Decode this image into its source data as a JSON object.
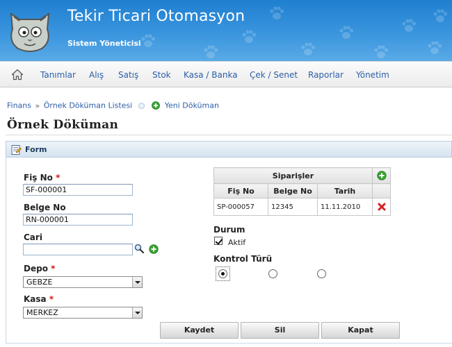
{
  "app": {
    "title": "Tekir Ticari Otomasyon",
    "subtitle": "Sistem Yöneticisi"
  },
  "nav": {
    "items": [
      "Tanımlar",
      "Alış",
      "Satış",
      "Stok",
      "Kasa / Banka",
      "Çek / Senet",
      "Raporlar",
      "Yönetim"
    ]
  },
  "breadcrumb": {
    "root": "Finans",
    "separator": "»",
    "list": "Örnek Döküman Listesi",
    "new": "Yeni Döküman"
  },
  "page": {
    "title": "Örnek Döküman"
  },
  "panel": {
    "title": "Form"
  },
  "form": {
    "fis_no": {
      "label": "Fiş No",
      "required": "*",
      "value": "SF-000001"
    },
    "belge_no": {
      "label": "Belge No",
      "value": "RN-000001"
    },
    "cari": {
      "label": "Cari",
      "value": ""
    },
    "depo": {
      "label": "Depo",
      "required": "*",
      "value": "GEBZE"
    },
    "kasa": {
      "label": "Kasa",
      "required": "*",
      "value": "MERKEZ"
    }
  },
  "orders": {
    "title": "Siparişler",
    "columns": [
      "Fiş No",
      "Belge No",
      "Tarih"
    ],
    "rows": [
      {
        "fis_no": "SP-000057",
        "belge_no": "12345",
        "tarih": "11.11.2010"
      }
    ]
  },
  "durum": {
    "label": "Durum",
    "checkbox_label": "Aktif",
    "checked": true
  },
  "kontrol": {
    "label": "Kontrol Türü",
    "selected_index": 0,
    "options_count": 3
  },
  "buttons": {
    "save": "Kaydet",
    "delete": "Sil",
    "close": "Kapat"
  },
  "colors": {
    "header_blue": "#2b8ad8",
    "link_blue": "#2a5ea8",
    "required_red": "#d11111",
    "add_green": "#3aa335",
    "delete_red": "#d42020"
  }
}
